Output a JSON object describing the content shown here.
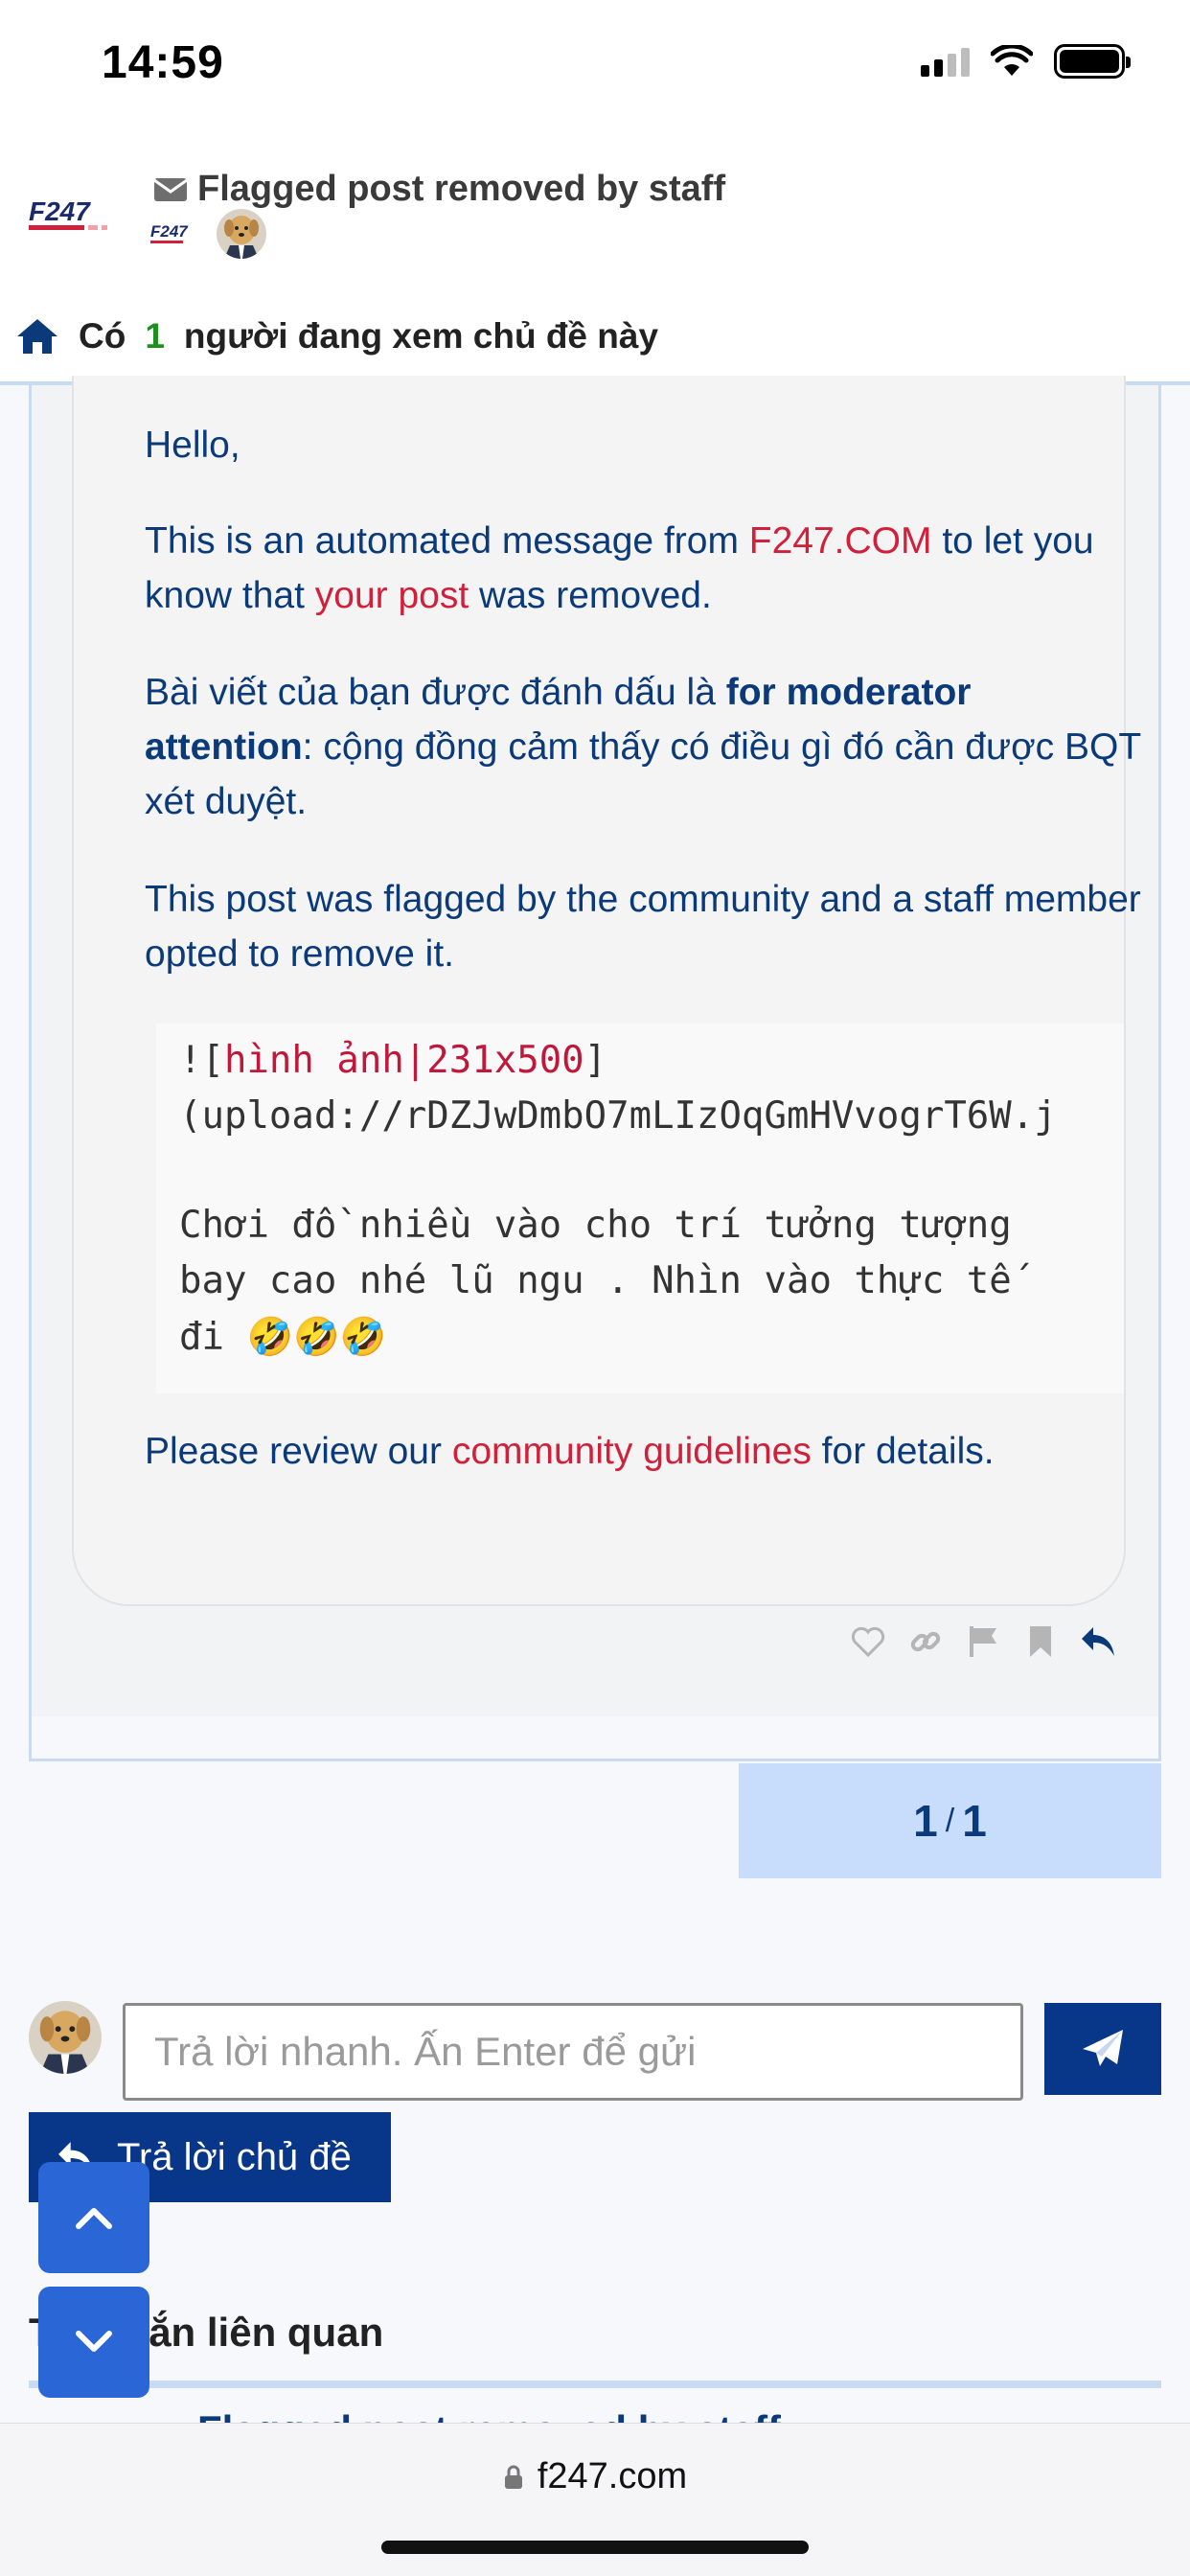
{
  "status_bar": {
    "time": "14:59"
  },
  "header": {
    "topic_title": "Flagged post removed by staff",
    "logo_text": "F247",
    "viewers": {
      "prefix": "Có",
      "count": "1",
      "suffix": "người đang xem chủ đề này"
    }
  },
  "post": {
    "greeting": "Hello,",
    "p1": {
      "a": "This is an automated message from ",
      "site": "F247.COM",
      "b": " to let you know that ",
      "link": "your post",
      "c": " was removed."
    },
    "p2": {
      "a": "Bài viết của bạn được đánh dấu là ",
      "bold": "for moderator attention",
      "b": ": cộng đồng cảm thấy có điều gì đó cần được BQT xét duyệt."
    },
    "p3": "This post was flagged by the community and a staff member opted to remove it.",
    "code": {
      "line1_a": "![",
      "line1_b": "hình ảnh|231x500",
      "line1_c": "]",
      "line2": "(upload://rDZJwDmbO7mLIzOqGmHVvogrT6W.j",
      "line3": "Chơi đồ nhiều vào cho trí tưởng tượng",
      "line4": "bay cao nhé lũ ngu . Nhìn vào thực tế",
      "line5": "đi 🤣🤣🤣"
    },
    "p4": {
      "a": "Please review our ",
      "link": "community guidelines",
      "b": " for details."
    },
    "actions": [
      "heart-icon",
      "link-icon",
      "flag-icon",
      "bookmark-icon",
      "reply-icon"
    ]
  },
  "pager": {
    "current": "1",
    "sep": "/",
    "total": "1"
  },
  "reply": {
    "placeholder": "Trả lời nhanh. Ấn Enter để gửi",
    "topic_button": "Trả lời chủ đề"
  },
  "related": {
    "title": "Tin nhắn liên quan",
    "first_item": "Flagged post removed by staff"
  },
  "browser": {
    "url": "f247.com"
  },
  "colors": {
    "primary": "#08378a",
    "accent_red": "#d0203a",
    "text_blue": "#0b3a7a",
    "pager_bg": "#c8dcfb"
  }
}
